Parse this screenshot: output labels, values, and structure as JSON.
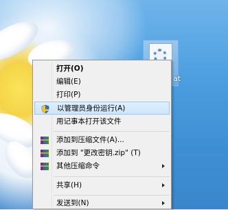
{
  "desktop": {
    "file_label": "at"
  },
  "context_menu": {
    "items": [
      {
        "label": "打开(O)",
        "bold": true
      },
      {
        "label": "编辑(E)"
      },
      {
        "label": "打印(P)"
      },
      {
        "label": "以管理员身份运行(A)",
        "icon": "uac-shield-icon",
        "highlighted": true
      },
      {
        "label": "用记事本打开该文件"
      },
      {
        "label": "添加到压缩文件(A)...",
        "icon": "winrar-icon"
      },
      {
        "label": "添加到 \"更改密钥.zip\" (T)",
        "icon": "winrar-icon"
      },
      {
        "label": "其他压缩命令",
        "icon": "winrar-icon",
        "submenu": true
      },
      {
        "label": "共享(H)",
        "submenu": true
      },
      {
        "label": "发送到(N)",
        "submenu": true
      }
    ]
  },
  "colors": {
    "menu_bg": "#f0f0f0",
    "highlight_bg": "#cde5fb",
    "highlight_border": "#9cc6ee"
  }
}
